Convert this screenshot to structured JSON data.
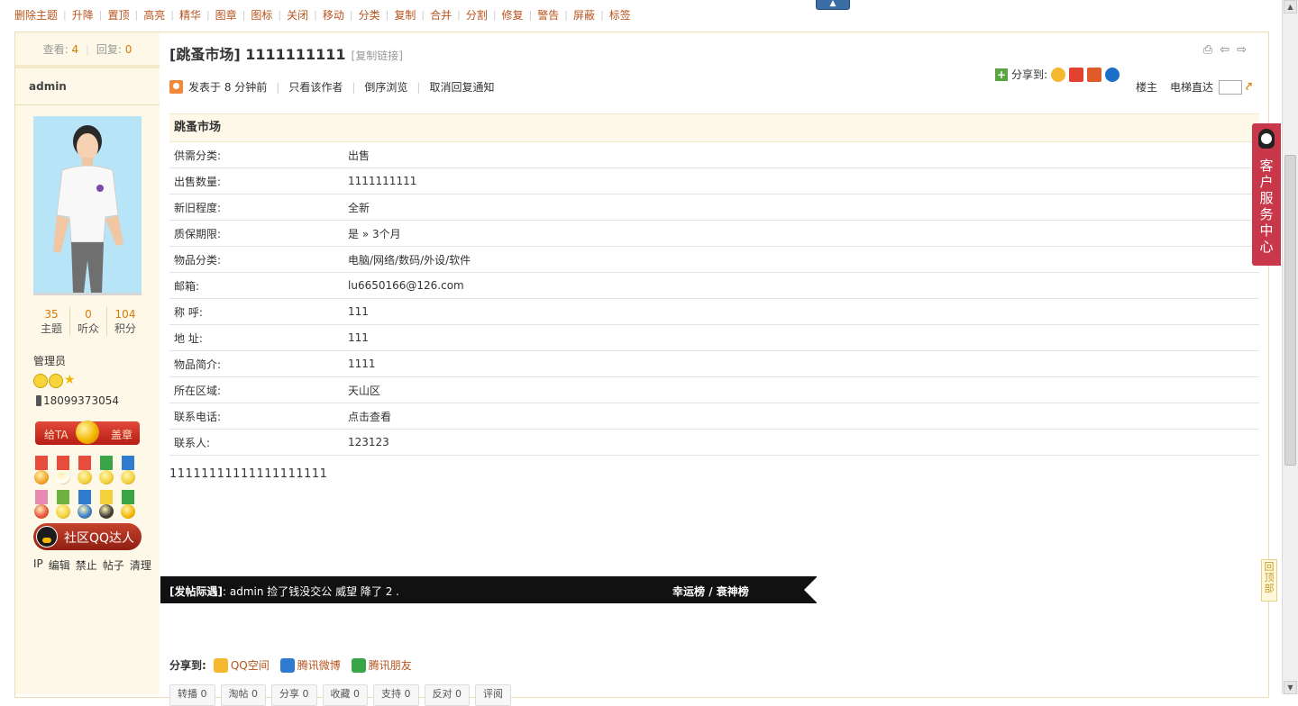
{
  "toolbar": {
    "items": [
      "删除主题",
      "升降",
      "置顶",
      "高亮",
      "精华",
      "图章",
      "图标",
      "关闭",
      "移动",
      "分类",
      "复制",
      "合并",
      "分割",
      "修复",
      "警告",
      "屏蔽",
      "标签"
    ]
  },
  "sidebar": {
    "views_label": "查看:",
    "views": "4",
    "replies_label": "回复:",
    "replies": "0",
    "username": "admin",
    "counts": [
      {
        "value": "35",
        "label": "主题"
      },
      {
        "value": "0",
        "label": "听众"
      },
      {
        "value": "104",
        "label": "积分"
      }
    ],
    "role": "管理员",
    "phone": "18099373054",
    "stamp_left": "给TA",
    "stamp_right": "盖章",
    "qq_button": "社区QQ达人",
    "links": [
      "IP",
      "编辑",
      "禁止",
      "帖子",
      "清理"
    ]
  },
  "post": {
    "title": "[跳蚤市场] 1111111111",
    "copy_link": "[复制链接]",
    "posted": "发表于",
    "posted_time": "8 分钟前",
    "only_author": "只看该作者",
    "reverse": "倒序浏览",
    "cancel_notify": "取消回复通知",
    "share_label": "分享到:",
    "floor_label": "楼主",
    "elevator_label": "电梯直达"
  },
  "info_table": {
    "caption": "跳蚤市场",
    "rows": [
      {
        "k": "供需分类:",
        "v": "出售"
      },
      {
        "k": "出售数量:",
        "v": "1111111111"
      },
      {
        "k": "新旧程度:",
        "v": "全新"
      },
      {
        "k": "质保期限:",
        "v": "是 » 3个月"
      },
      {
        "k": "物品分类:",
        "v": "电脑/网络/数码/外设/软件"
      },
      {
        "k": "邮箱:",
        "v": "lu6650166@126.com"
      },
      {
        "k": "称 呼:",
        "v": "111"
      },
      {
        "k": "地 址:",
        "v": "111"
      },
      {
        "k": "物品简介:",
        "v": "1111"
      },
      {
        "k": "所在区域:",
        "v": "天山区"
      },
      {
        "k": "联系电话:",
        "v": "点击查看"
      },
      {
        "k": "联系人:",
        "v": "123123"
      }
    ]
  },
  "body_text": "11111111111111111111",
  "banner": {
    "tag": "[发帖际遇]",
    "text": ": admin 捡了钱没交公 威望 降了 2 .",
    "lucky": "幸运榜",
    "slash": " / ",
    "unlucky": "衰神榜"
  },
  "share_bottom": {
    "label": "分享到:",
    "options": [
      "QQ空间",
      "腾讯微博",
      "腾讯朋友"
    ]
  },
  "actions": [
    "转播 0",
    "淘帖 0",
    "分享 0",
    "收藏 0",
    "支持 0",
    "反对 0",
    "评阅"
  ],
  "service_tab": "客户服务中心",
  "back_to_top": "回顶部",
  "colors": {
    "accent": "#b8541e",
    "number": "#d27b07",
    "sidebar_bg": "#fdf8e8",
    "banner_bg": "#111111",
    "service_tab": "#c8384a"
  }
}
